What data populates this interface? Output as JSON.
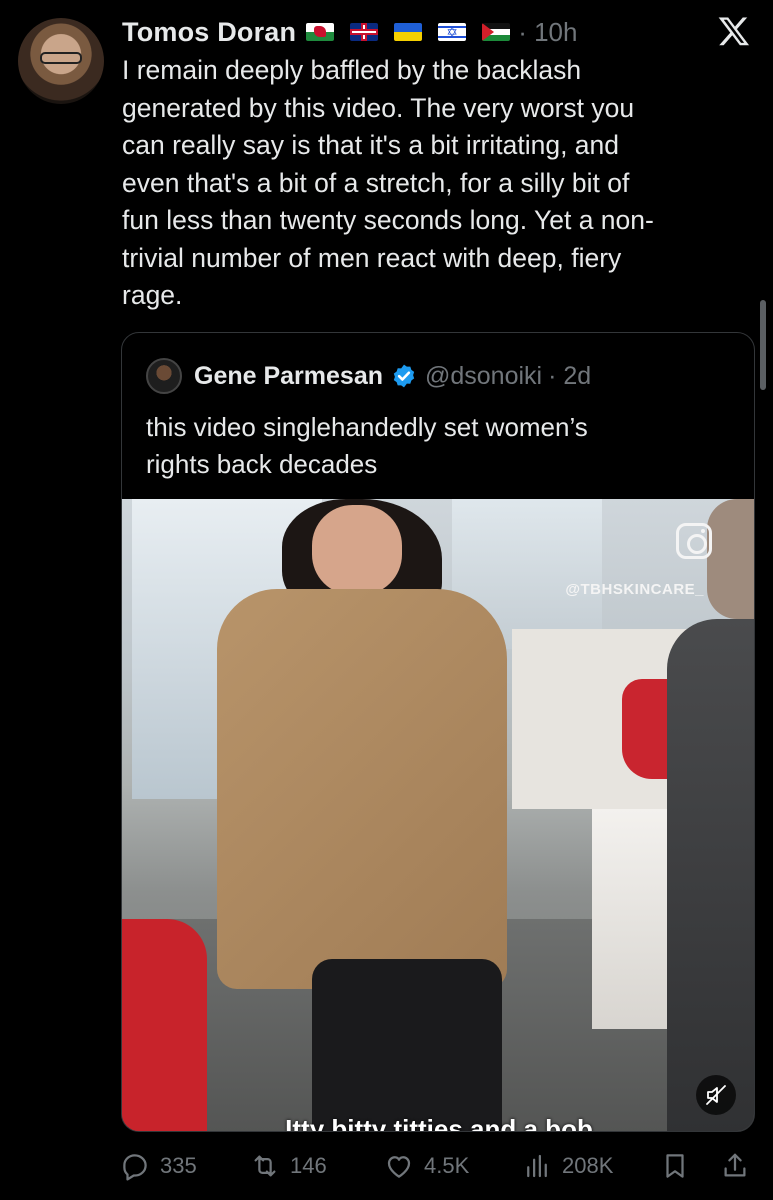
{
  "post": {
    "author_name": "Tomos Doran",
    "time": "· 10h",
    "flags": [
      "wales-flag",
      "uk-flag",
      "ukraine-flag",
      "israel-flag",
      "palestine-flag"
    ],
    "text": "I remain deeply baffled by the backlash\ngenerated by this video. The very worst you\ncan really say is that it's a bit irritating, and\neven that's a bit of a stretch, for a silly bit of\nfun less than twenty seconds long. Yet a non-\ntrivial number of men react with deep, fiery\nrage."
  },
  "quote": {
    "name": "Gene Parmesan",
    "handle": "@dsonoiki",
    "time": "· 2d",
    "text": "this video singlehandedly set women’s\nrights back decades",
    "video": {
      "watermark": "@TBHSKINCARE_",
      "caption": "Itty bitty titties and a bob"
    }
  },
  "actions": {
    "replies": "335",
    "reposts": "146",
    "likes": "4.5K",
    "views": "208K"
  },
  "colors": {
    "background": "#000000",
    "text": "#e7e9ea",
    "secondary": "#71767b",
    "verified": "#1d9bf0",
    "border": "#333639"
  }
}
